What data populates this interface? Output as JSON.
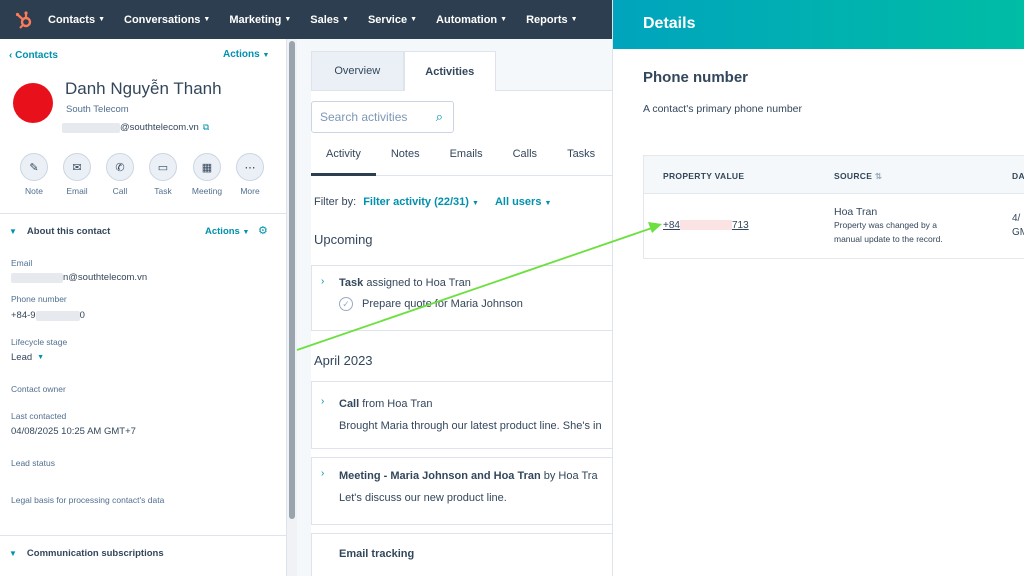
{
  "nav": {
    "items": [
      {
        "label": "Contacts"
      },
      {
        "label": "Conversations"
      },
      {
        "label": "Marketing"
      },
      {
        "label": "Sales"
      },
      {
        "label": "Service"
      },
      {
        "label": "Automation"
      },
      {
        "label": "Reports"
      }
    ]
  },
  "contact": {
    "back_label": "Contacts",
    "actions_label": "Actions",
    "name": "Danh Nguyễn Thanh",
    "company": "South Telecom",
    "email_domain": "@southtelecom.vn"
  },
  "quick_actions": [
    {
      "label": "Note",
      "icon": "note-icon"
    },
    {
      "label": "Email",
      "icon": "email-icon"
    },
    {
      "label": "Call",
      "icon": "call-icon"
    },
    {
      "label": "Task",
      "icon": "task-icon"
    },
    {
      "label": "Meeting",
      "icon": "meeting-icon"
    },
    {
      "label": "More",
      "icon": "more-icon"
    }
  ],
  "about": {
    "title": "About this contact",
    "actions_label": "Actions",
    "fields": {
      "email_label": "Email",
      "email_value": "n@southtelecom.vn",
      "phone_label": "Phone number",
      "phone_prefix": "+84-9",
      "phone_suffix": "0",
      "lifecycle_label": "Lifecycle stage",
      "lifecycle_value": "Lead",
      "owner_label": "Contact owner",
      "last_contacted_label": "Last contacted",
      "last_contacted_value": "04/08/2025 10:25 AM GMT+7",
      "lead_status_label": "Lead status",
      "legal_basis_label": "Legal basis for processing contact's data"
    }
  },
  "comm_subscriptions": {
    "title": "Communication subscriptions"
  },
  "middle": {
    "tab_overview": "Overview",
    "tab_activities": "Activities",
    "search_placeholder": "Search activities",
    "subtabs": [
      "Activity",
      "Notes",
      "Emails",
      "Calls",
      "Tasks"
    ],
    "filter_by": "Filter by:",
    "filter_activity": "Filter activity (22/31)",
    "all_users": "All users",
    "upcoming": "Upcoming",
    "task_title": "Task",
    "task_rest": " assigned to Hoa Tran",
    "task_body": "Prepare quote for Maria Johnson",
    "april": "April 2023",
    "call_title": "Call",
    "call_rest": " from Hoa Tran",
    "call_body": "Brought Maria through our latest product line. She's in",
    "meeting_title": "Meeting - Maria Johnson and Hoa Tran",
    "meeting_rest": " by Hoa Tra",
    "meeting_body": "Let's discuss our new product line.",
    "email_tracking": "Email tracking"
  },
  "details": {
    "title": "Details",
    "property_title": "Phone number",
    "property_desc": "A contact's primary phone number",
    "col_value": "PROPERTY VALUE",
    "col_source": "SOURCE",
    "col_date": "DA",
    "phone_prefix": "+84",
    "phone_suffix": "713",
    "source_name": "Hoa Tran",
    "source_line1": "Property was changed by a",
    "source_line2": "manual update to the record.",
    "date_line1": "4/",
    "date_line2": "GM"
  },
  "colors": {
    "nav_bg": "#2d3e50",
    "accent": "#0091ae",
    "header_gradient_start": "#00a4bd",
    "header_gradient_end": "#00bda5",
    "avatar": "#e8101a",
    "arrow": "#6be03e",
    "logo": "#ff7a59"
  }
}
